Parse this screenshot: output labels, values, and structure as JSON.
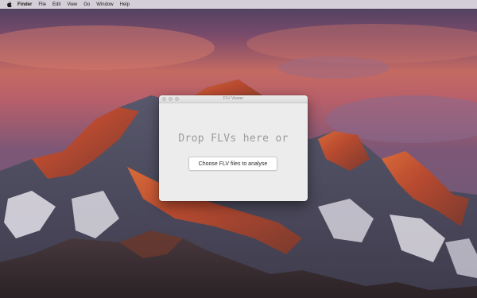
{
  "menubar": {
    "apple_icon": "apple-icon",
    "items": [
      "Finder",
      "File",
      "Edit",
      "View",
      "Go",
      "Window",
      "Help"
    ]
  },
  "window": {
    "title": "FLV Viewer",
    "drop_text": "Drop FLVs here or",
    "button_label": "Choose FLV files to analyse"
  },
  "colors": {
    "window_bg": "#ececec",
    "drop_text": "#9b9b9b",
    "button_bg": "#ffffff"
  }
}
